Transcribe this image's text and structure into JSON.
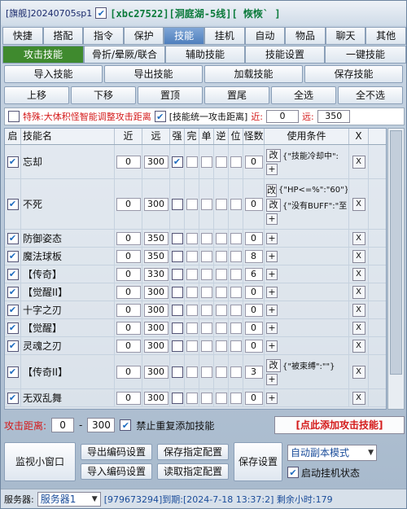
{
  "titlebar": {
    "prefix": "[旗舰]20240705sp1",
    "account": "[xbc27522][洞庭湖-5线][ 恢恢` ]"
  },
  "tabs": [
    "快捷",
    "搭配",
    "指令",
    "保护",
    "技能",
    "挂机",
    "自动",
    "物品",
    "聊天",
    "其他"
  ],
  "subtabs": [
    "攻击技能",
    "骨折/晕厥/联合",
    "辅助技能",
    "技能设置",
    "一键技能"
  ],
  "actions_row1": [
    "导入技能",
    "导出技能",
    "加载技能",
    "保存技能"
  ],
  "actions_row2": [
    "上移",
    "下移",
    "置顶",
    "置尾",
    "全选",
    "全不选"
  ],
  "options": {
    "special_label": "特殊:大体积怪智能调整攻击距离",
    "unify_label": "[技能统一攻击距离]",
    "near_label": "近:",
    "near_value": "0",
    "far_label": "远:",
    "far_value": "350"
  },
  "table": {
    "headers": [
      "启",
      "技能名",
      "近",
      "远",
      "强",
      "完",
      "单",
      "逆",
      "位",
      "怪数",
      "使用条件",
      "X"
    ],
    "rows": [
      {
        "name": "忘却",
        "near": "0",
        "far": "300",
        "qiang": true,
        "count": "0",
        "gai": "改",
        "cond": [
          "{\"技能冷却中\":"
        ],
        "x": "X"
      },
      {
        "name": "不死",
        "near": "0",
        "far": "300",
        "qiang": false,
        "count": "0",
        "gai": "改",
        "cond": [
          "{\"HP<=%\":\"60\"}",
          "{\"没有BUFF\":\"至"
        ],
        "x": "X"
      },
      {
        "name": "防御姿态",
        "near": "0",
        "far": "350",
        "qiang": false,
        "count": "0",
        "gai": "",
        "cond": [],
        "x": "X"
      },
      {
        "name": "魔法球板",
        "near": "0",
        "far": "350",
        "qiang": false,
        "count": "8",
        "gai": "",
        "cond": [],
        "x": "X"
      },
      {
        "name": "【传奇】",
        "near": "0",
        "far": "330",
        "qiang": false,
        "count": "6",
        "gai": "",
        "cond": [],
        "x": "X"
      },
      {
        "name": "【觉醒II】",
        "near": "0",
        "far": "300",
        "qiang": false,
        "count": "0",
        "gai": "",
        "cond": [],
        "x": "X"
      },
      {
        "name": "十字之刃",
        "near": "0",
        "far": "300",
        "qiang": false,
        "count": "0",
        "gai": "",
        "cond": [],
        "x": "X"
      },
      {
        "name": "【觉醒】",
        "near": "0",
        "far": "300",
        "qiang": false,
        "count": "0",
        "gai": "",
        "cond": [],
        "x": "X"
      },
      {
        "name": "灵魂之刃",
        "near": "0",
        "far": "300",
        "qiang": false,
        "count": "0",
        "gai": "",
        "cond": [],
        "x": "X"
      },
      {
        "name": "【传奇II】",
        "near": "0",
        "far": "300",
        "qiang": false,
        "count": "3",
        "gai": "改",
        "cond": [
          "{\"被束缚\":\"\"}"
        ],
        "x": "X"
      },
      {
        "name": "无双乱舞",
        "near": "0",
        "far": "300",
        "qiang": false,
        "count": "0",
        "gai": "",
        "cond": [],
        "x": "X"
      }
    ]
  },
  "distance": {
    "label": "攻击距离:",
    "from": "0",
    "dash": "-",
    "to": "300",
    "no_dup_label": "禁止重复添加技能",
    "add_button": "[点此添加攻击技能]"
  },
  "bottom": {
    "monitor": "监视小窗口",
    "export_code": "导出编码设置",
    "import_code": "导入编码设置",
    "save_config": "保存指定配置",
    "read_config": "读取指定配置",
    "save_settings": "保存设置",
    "mode": "自动副本模式",
    "startup_label": "启动挂机状态"
  },
  "status": {
    "server_label": "服务器:",
    "server_value": "服务器1",
    "info": "[979673294]到期:[2024-7-18 13:37:2] 剩余小时:179"
  }
}
